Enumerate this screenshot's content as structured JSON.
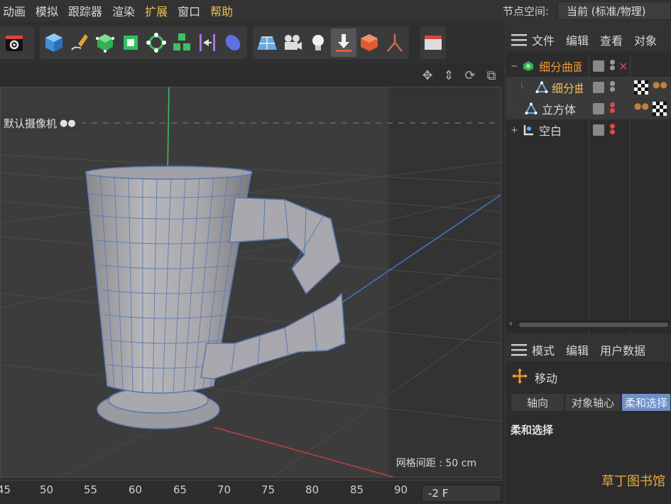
{
  "menubar": {
    "items": [
      {
        "label": "动画"
      },
      {
        "label": "模拟"
      },
      {
        "label": "跟踪器"
      },
      {
        "label": "渲染"
      },
      {
        "label": "扩展",
        "highlight": true
      },
      {
        "label": "窗口"
      },
      {
        "label": "帮助",
        "highlight": true
      }
    ],
    "node_space_label": "节点空间:",
    "node_space_value": "当前 (标准/物理)"
  },
  "toolbar": {
    "icons": [
      "render-settings-icon",
      "cube-icon",
      "pen-spline-icon",
      "subdivision-surface-icon",
      "extrude-icon",
      "mograph-cloner-icon",
      "array-cubes-icon",
      "symmetry-icon",
      "deformer-icon",
      "floor-icon",
      "camera-icon",
      "light-icon",
      "drop-to-floor-icon",
      "cube-tool-icon",
      "joint-icon",
      "script-icon"
    ]
  },
  "viewport": {
    "camera_label": "默认摄像机",
    "grid_label": "网格间距 : 50 cm"
  },
  "timeline": {
    "ticks": [
      "45",
      "50",
      "55",
      "60",
      "65",
      "70",
      "75",
      "80",
      "85",
      "90"
    ],
    "frame_value": "-2 F"
  },
  "object_manager": {
    "header": [
      "文件",
      "编辑",
      "查看",
      "对象"
    ],
    "rows": [
      {
        "name": "细分曲面",
        "color": "orange",
        "icon": "subdivision-surface-icon",
        "expander": "−",
        "indent": 0
      },
      {
        "name": "细分曲面",
        "color": "yellow",
        "icon": "polygon-object-icon",
        "expander": "",
        "indent": 1
      },
      {
        "name": "立方体",
        "color": "default",
        "icon": "polygon-object-icon",
        "expander": "",
        "indent": 0
      },
      {
        "name": "空白",
        "color": "default",
        "icon": "null-object-icon",
        "expander": "+",
        "indent": 0
      }
    ]
  },
  "attribute_manager": {
    "header": [
      "模式",
      "编辑",
      "用户数据"
    ],
    "mode_label": "移动",
    "tabs": [
      {
        "label": "轴向",
        "active": false
      },
      {
        "label": "对象轴心",
        "active": false
      },
      {
        "label": "柔和选择",
        "active": true
      }
    ],
    "section_title": "柔和选择"
  },
  "watermark": "草丁图书馆"
}
